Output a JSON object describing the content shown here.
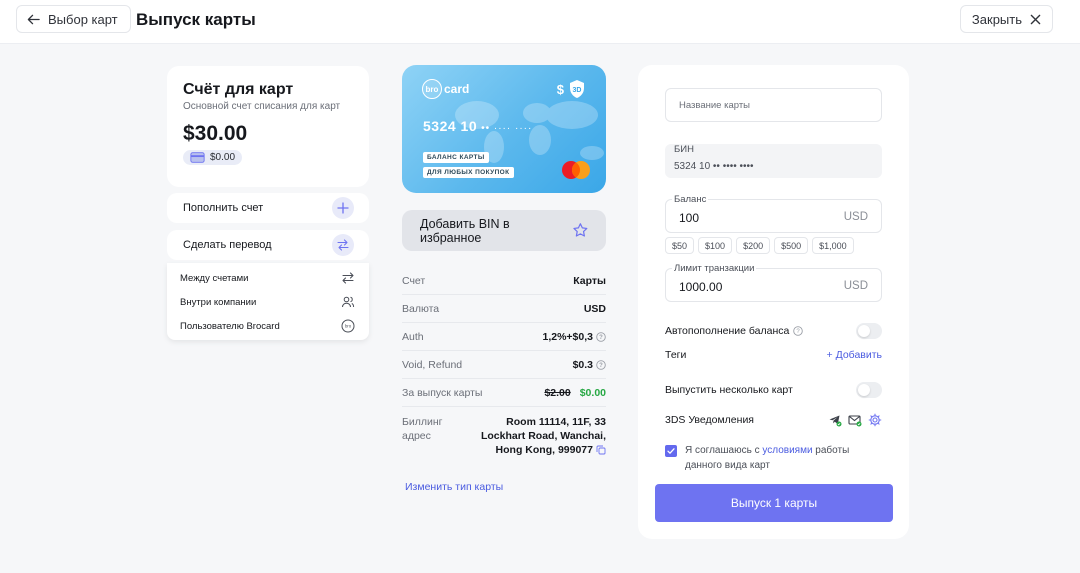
{
  "header": {
    "back_label": "Выбор карт",
    "title": "Выпуск карты",
    "close_label": "Закрыть"
  },
  "account": {
    "title": "Счёт для карт",
    "subtitle": "Основной счет списания для карт",
    "amount": "$30.00",
    "chip_amount": "$0.00"
  },
  "actions": {
    "topup": "Пополнить счет",
    "transfer": "Сделать перевод",
    "submenu": [
      {
        "label": "Между счетами",
        "icon": "swap-arrows-icon"
      },
      {
        "label": "Внутри компании",
        "icon": "users-icon"
      },
      {
        "label": "Пользователю Brocard",
        "icon": "brocard-icon"
      }
    ]
  },
  "card": {
    "brand": "card",
    "brand_prefix": "bro",
    "badge": "3D",
    "currency_symbol": "$",
    "number_prefix": "5324 10",
    "number_mask": "•• ···· ····",
    "tag1": "БАЛАНС КАРТЫ",
    "tag2": "ДЛЯ ЛЮБЫХ ПОКУПОК",
    "colors": {
      "gradient_start": "#8fd3f6",
      "gradient_end": "#3aa7e8"
    }
  },
  "bin_button": "Добавить BIN в избранное",
  "info": {
    "account_label": "Счет",
    "account_value": "Карты",
    "currency_label": "Валюта",
    "currency_value": "USD",
    "auth_label": "Auth",
    "auth_value": "1,2%+$0,3",
    "void_label": "Void, Refund",
    "void_value": "$0.3",
    "issue_label": "За выпуск карты",
    "issue_old": "$2.00",
    "issue_new": "$0.00",
    "billing_label_1": "Биллинг",
    "billing_label_2": "адрес",
    "billing_value": "Room 11114, 11F, 33 Lockhart Road, Wanchai, Hong Kong, 999077"
  },
  "change_link": "Изменить тип карты",
  "form": {
    "name_placeholder": "Название карты",
    "bin_label": "БИН",
    "bin_value": "5324 10 •• •••• ••••",
    "balance_label": "Баланс",
    "balance_value": "100",
    "balance_unit": "USD",
    "presets": [
      "$50",
      "$100",
      "$200",
      "$500",
      "$1,000"
    ],
    "limit_label": "Лимит транзакции",
    "limit_value": "1000.00",
    "limit_unit": "USD",
    "autotopup_label": "Автопополнение баланса",
    "tags_label": "Теги",
    "tags_add": "+ Добавить",
    "multi_label": "Выпустить несколько карт",
    "notify_label": "3DS Уведомления",
    "agree_prefix": "Я соглашаюсь с ",
    "agree_link": "условиями",
    "agree_suffix": " работы данного вида карт",
    "submit": "Выпуск 1 карты"
  },
  "colors": {
    "accent": "#6e73f1",
    "link": "#4a5be0",
    "success": "#27a844"
  }
}
